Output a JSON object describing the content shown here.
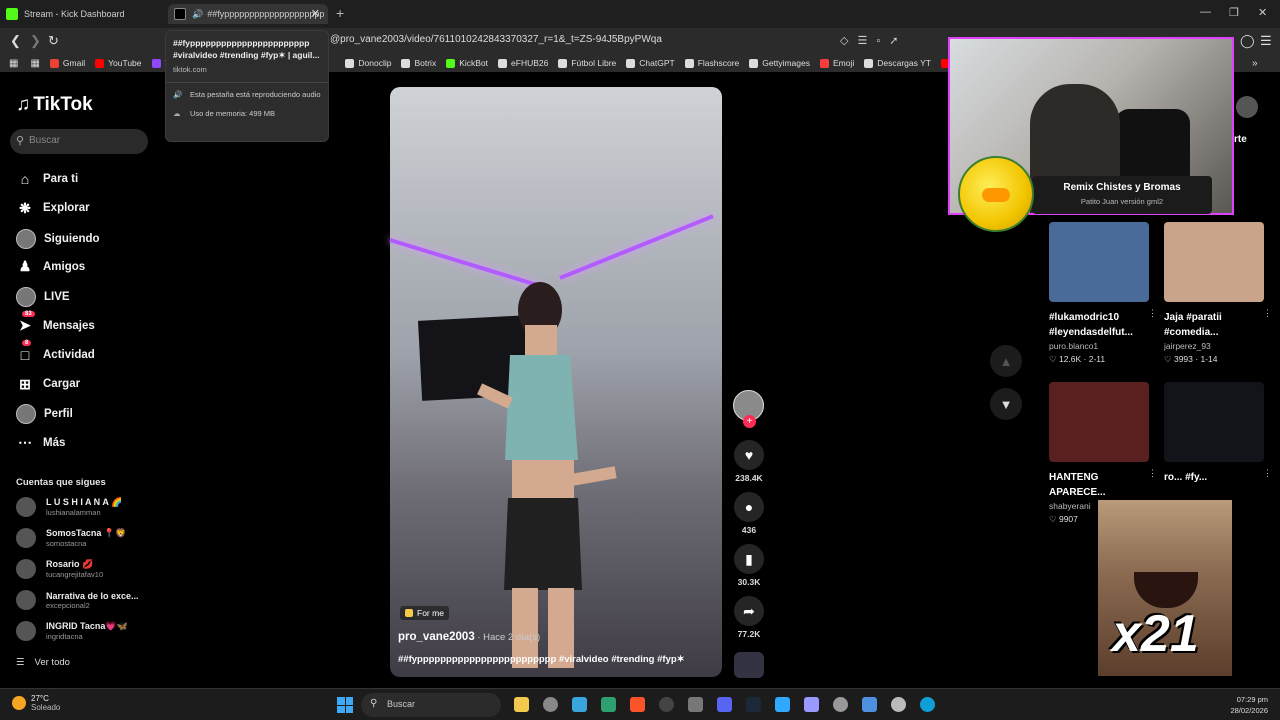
{
  "browser": {
    "tabs": [
      {
        "title": "Stream - Kick Dashboard"
      },
      {
        "title": "##fypppppppppppppppppppp"
      }
    ],
    "url": "@pro_vane2003/video/7611010242843370327_r=1&_t=ZS-94J5BpyPWqa",
    "hovercard": {
      "title": "##fyppppppppppppppppppppppp #viralvideo #trending #fyp✶ | aguil...",
      "domain": "tiktok.com",
      "audio": "Esta pestaña está reproduciendo audio",
      "memory": "Uso de memoria: 499 MB"
    },
    "bookmarks": [
      {
        "label": "Gmail",
        "color": "#ea4335"
      },
      {
        "label": "YouTube",
        "color": "#ff0000"
      },
      {
        "label": "Tw",
        "color": "#9146ff"
      },
      {
        "label": "Donoclip",
        "color": "#dddddd"
      },
      {
        "label": "Botrix",
        "color": "#dddddd"
      },
      {
        "label": "KickBot",
        "color": "#53fc18"
      },
      {
        "label": "eFHUB26",
        "color": "#dddddd"
      },
      {
        "label": "Fútbol Libre",
        "color": "#dddddd"
      },
      {
        "label": "ChatGPT",
        "color": "#dddddd"
      },
      {
        "label": "Flashscore",
        "color": "#dddddd"
      },
      {
        "label": "Gettyimages",
        "color": "#dddddd"
      },
      {
        "label": "Emoji",
        "color": "#ff3d3d"
      },
      {
        "label": "Descargas YT",
        "color": "#dddddd"
      },
      {
        "label": "Mix N",
        "color": "#ff0000"
      }
    ]
  },
  "tiktok": {
    "logo": "TikTok",
    "search_placeholder": "Buscar",
    "nav": [
      {
        "label": "Para ti",
        "icon": "home-icon"
      },
      {
        "label": "Explorar",
        "icon": "compass-icon"
      },
      {
        "label": "Siguiendo",
        "icon": "following-avatar-icon"
      },
      {
        "label": "Amigos",
        "icon": "friends-icon"
      },
      {
        "label": "LIVE",
        "icon": "live-avatar-icon"
      },
      {
        "label": "Mensajes",
        "icon": "messages-icon",
        "badge": "83"
      },
      {
        "label": "Actividad",
        "icon": "activity-icon",
        "badge": "8"
      },
      {
        "label": "Cargar",
        "icon": "upload-icon"
      },
      {
        "label": "Perfil",
        "icon": "profile-icon"
      },
      {
        "label": "Más",
        "icon": "more-icon"
      }
    ],
    "following_title": "Cuentas que sigues",
    "following": [
      {
        "name": "L U S H I A N A 🌈",
        "handle": "lushianalamman"
      },
      {
        "name": "SomosTacna 📍🦁",
        "handle": "somostacna"
      },
      {
        "name": "Rosario 💋",
        "handle": "tucangrejitafav10"
      },
      {
        "name": "Narrativa de lo exce...",
        "handle": "excepcional2"
      },
      {
        "name": "INGRID Tacna💗🦋",
        "handle": "ingridtacna"
      }
    ],
    "see_all": "Ver todo"
  },
  "video": {
    "badge": "For me",
    "author": "pro_vane2003",
    "time": " · Hace 2 día(s)",
    "caption": "##fypppppppppppppppppppppppp #viralvideo #trending #fyp✶",
    "likes": "238.4K",
    "comments": "436",
    "saves": "30.3K",
    "shares": "77.2K"
  },
  "overlay": {
    "remix_title": "Remix Chistes y Bromas",
    "remix_sub": "Patito Juan versión gml2",
    "meme_text": "x21"
  },
  "related": {
    "tab_label": "rte",
    "cards": [
      {
        "title": "#lukamodric10 #leyendasdelfut...",
        "author": "puro.blanco1",
        "meta": "♡ 12.6K · 2-11",
        "color": "#4a6a9a"
      },
      {
        "title": "Jaja #paratii #comedia...",
        "author": "jairperez_93",
        "meta": "♡ 3993 · 1-14",
        "color": "#c9a48a"
      },
      {
        "title": "HANTENG APARECE...",
        "author": "shabyerani",
        "meta": "♡ 9907",
        "color": "#5a1f1f"
      },
      {
        "title": "ro... #fy...",
        "author": "",
        "meta": "",
        "color": "#111418"
      }
    ]
  },
  "taskbar": {
    "temp": "27°C",
    "weather": "Soleado",
    "search": "Buscar",
    "time": "07:29 pm",
    "date": "28/02/2026"
  }
}
